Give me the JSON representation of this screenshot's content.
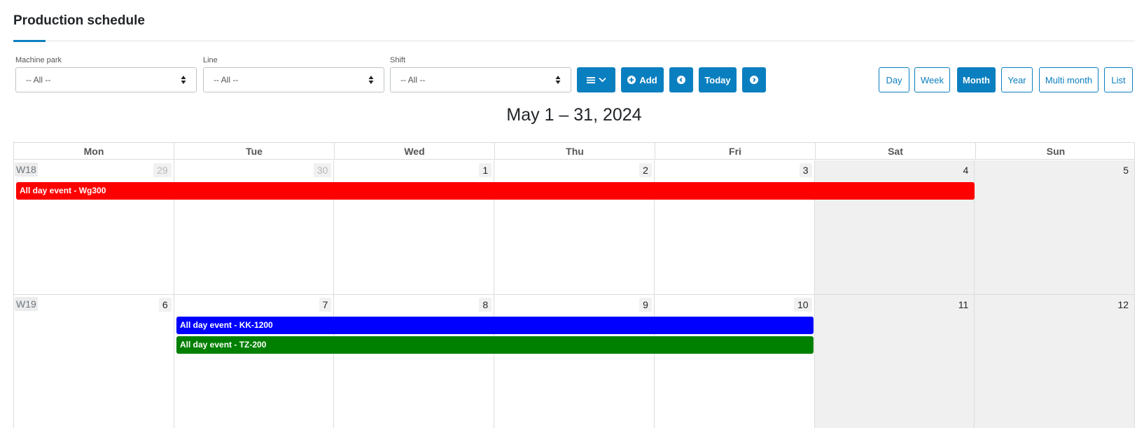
{
  "page": {
    "title": "Production schedule"
  },
  "filters": [
    {
      "label": "Machine park",
      "value": "-- All --"
    },
    {
      "label": "Line",
      "value": "-- All --"
    },
    {
      "label": "Shift",
      "value": "-- All --"
    }
  ],
  "toolbar": {
    "menu_icon": "list-icon",
    "add_label": "Add",
    "prev_icon": "chevron-left-icon",
    "today_label": "Today",
    "next_icon": "chevron-right-icon"
  },
  "views": {
    "day": "Day",
    "week": "Week",
    "month": "Month",
    "year": "Year",
    "multi_month": "Multi month",
    "list": "List",
    "active": "Month"
  },
  "calendar": {
    "range_title": "May 1 – 31, 2024",
    "weekdays": [
      "Mon",
      "Tue",
      "Wed",
      "Thu",
      "Fri",
      "Sat",
      "Sun"
    ],
    "weeks": [
      {
        "label": "W18",
        "days": [
          "29",
          "30",
          "1",
          "2",
          "3",
          "4",
          "5"
        ]
      },
      {
        "label": "W19",
        "days": [
          "6",
          "7",
          "8",
          "9",
          "10",
          "11",
          "12"
        ]
      }
    ],
    "events": [
      {
        "title": "All day event - Wg300",
        "color": "#ff0000"
      },
      {
        "title": "All day event - KK-1200",
        "color": "#0000ff"
      },
      {
        "title": "All day event - TZ-200",
        "color": "#008000"
      }
    ]
  },
  "colors": {
    "accent": "#0a7fc0",
    "weekend_bg": "#f0f0f0"
  }
}
